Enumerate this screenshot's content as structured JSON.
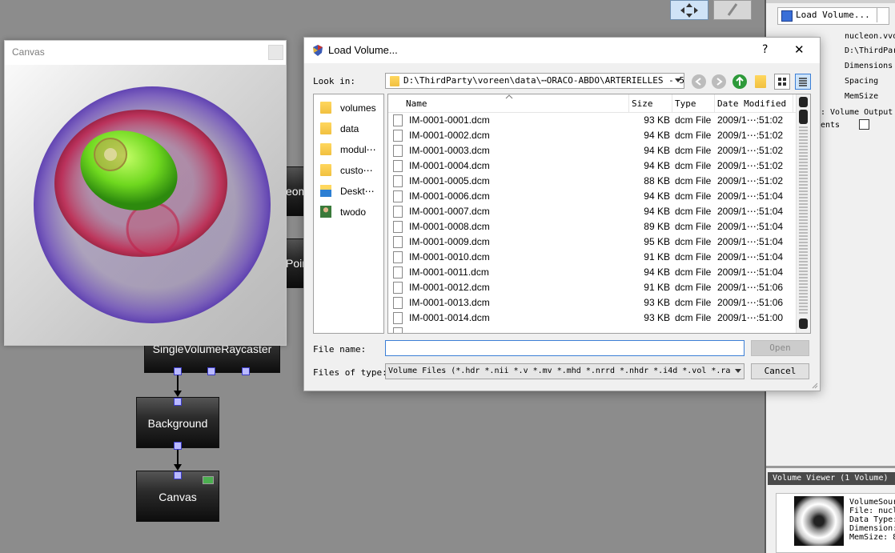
{
  "workspace": {
    "nodes": {
      "geometry_partial": "eom",
      "points_partial": "Poin",
      "raycaster": "SingleVolumeRaycaster",
      "background": "Background",
      "canvas": "Canvas"
    }
  },
  "canvas_window": {
    "title": "Canvas"
  },
  "right_panel": {
    "load_button": "Load Volume...",
    "filename": "nucleon.vvd",
    "path": "D:\\ThirdParty",
    "info_labels": [
      "Dimensions",
      "Spacing",
      "MemSize"
    ],
    "volume_output": ": Volume Output",
    "ments": "ents",
    "viewer_title": "Volume Viewer (1 Volume)",
    "viewer_info": [
      "VolumeSour",
      "File: nucl",
      "Data Type:",
      "Dimension:",
      "MemSize: 8"
    ]
  },
  "dialog": {
    "title": "Load Volume...",
    "help": "?",
    "close": "✕",
    "look_in_label": "Look in:",
    "look_in_path": "D:\\ThirdParty\\voreen\\data\\⋯ORACO-ABDO\\ARTERIELLES - 5",
    "places": [
      {
        "name": "volumes",
        "icon": "folder-icon"
      },
      {
        "name": "data",
        "icon": "folder-icon"
      },
      {
        "name": "modul⋯",
        "icon": "folder-icon"
      },
      {
        "name": "custo⋯",
        "icon": "folder-icon"
      },
      {
        "name": "Deskt⋯",
        "icon": "desktop-icon"
      },
      {
        "name": "twodo",
        "icon": "user-icon"
      }
    ],
    "columns": {
      "name": "Name",
      "size": "Size",
      "type": "Type",
      "date": "Date Modified"
    },
    "files": [
      {
        "name": "IM-0001-0001.dcm",
        "size": "93 KB",
        "type": "dcm File",
        "date": "2009/1⋯:51:02"
      },
      {
        "name": "IM-0001-0002.dcm",
        "size": "94 KB",
        "type": "dcm File",
        "date": "2009/1⋯:51:02"
      },
      {
        "name": "IM-0001-0003.dcm",
        "size": "94 KB",
        "type": "dcm File",
        "date": "2009/1⋯:51:02"
      },
      {
        "name": "IM-0001-0004.dcm",
        "size": "94 KB",
        "type": "dcm File",
        "date": "2009/1⋯:51:02"
      },
      {
        "name": "IM-0001-0005.dcm",
        "size": "88 KB",
        "type": "dcm File",
        "date": "2009/1⋯:51:02"
      },
      {
        "name": "IM-0001-0006.dcm",
        "size": "94 KB",
        "type": "dcm File",
        "date": "2009/1⋯:51:04"
      },
      {
        "name": "IM-0001-0007.dcm",
        "size": "94 KB",
        "type": "dcm File",
        "date": "2009/1⋯:51:04"
      },
      {
        "name": "IM-0001-0008.dcm",
        "size": "89 KB",
        "type": "dcm File",
        "date": "2009/1⋯:51:04"
      },
      {
        "name": "IM-0001-0009.dcm",
        "size": "95 KB",
        "type": "dcm File",
        "date": "2009/1⋯:51:04"
      },
      {
        "name": "IM-0001-0010.dcm",
        "size": "91 KB",
        "type": "dcm File",
        "date": "2009/1⋯:51:04"
      },
      {
        "name": "IM-0001-0011.dcm",
        "size": "94 KB",
        "type": "dcm File",
        "date": "2009/1⋯:51:04"
      },
      {
        "name": "IM-0001-0012.dcm",
        "size": "91 KB",
        "type": "dcm File",
        "date": "2009/1⋯:51:06"
      },
      {
        "name": "IM-0001-0013.dcm",
        "size": "93 KB",
        "type": "dcm File",
        "date": "2009/1⋯:51:06"
      },
      {
        "name": "IM-0001-0014.dcm",
        "size": "93 KB",
        "type": "dcm File",
        "date": "2009/1⋯:51:00"
      }
    ],
    "file_name_label": "File name:",
    "file_name_value": "",
    "open_button": "Open",
    "files_of_type_label": "Files of type:",
    "files_of_type_value": "Volume Files (*.hdr *.nii *.v *.mv *.mhd *.nrrd *.nhdr *.i4d *.vol *.ra",
    "cancel_button": "Cancel"
  }
}
